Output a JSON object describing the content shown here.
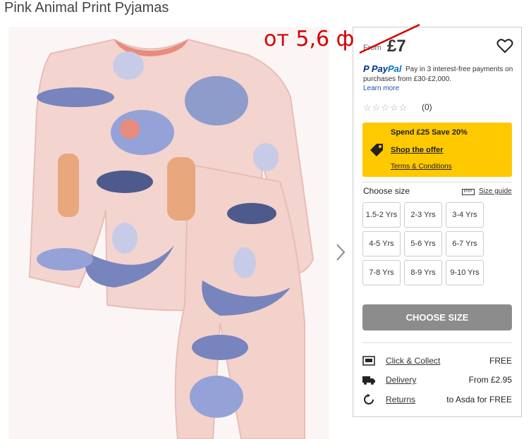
{
  "product": {
    "title": "Pink Animal Print Pyjamas",
    "price_prefix": "From",
    "price": "£7"
  },
  "paypal": {
    "logo_pay": "Pay",
    "logo_pal": "Pal",
    "text": "Pay in 3 interest-free payments on purchases from £30-£2,000.",
    "learn_more": "Learn more"
  },
  "rating": {
    "stars": "☆☆☆☆☆",
    "stars_filled": 0,
    "review_count": "(0)"
  },
  "offer": {
    "title": "Spend £25 Save 20%",
    "link": "Shop the offer",
    "terms": "Terms & Conditions",
    "bg_color": "#ffc900"
  },
  "size": {
    "label": "Choose size",
    "guide": "Size guide",
    "options": [
      "1.5-2 Yrs",
      "2-3 Yrs",
      "3-4 Yrs",
      "4-5 Yrs",
      "5-6 Yrs",
      "6-7 Yrs",
      "7-8 Yrs",
      "8-9 Yrs",
      "9-10 Yrs"
    ],
    "button": "CHOOSE SIZE"
  },
  "services": [
    {
      "icon": "store-icon",
      "label": "Click & Collect",
      "value": "FREE"
    },
    {
      "icon": "truck-icon",
      "label": "Delivery",
      "value": "From £2.95"
    },
    {
      "icon": "returns-icon",
      "label": "Returns",
      "value": "to Asda for FREE"
    }
  ],
  "annotation": {
    "text": "от 5,6 ф",
    "color": "#d40000"
  },
  "gallery": {
    "next_icon": "chevron-right-icon",
    "image": "pyjamas-product-image"
  }
}
